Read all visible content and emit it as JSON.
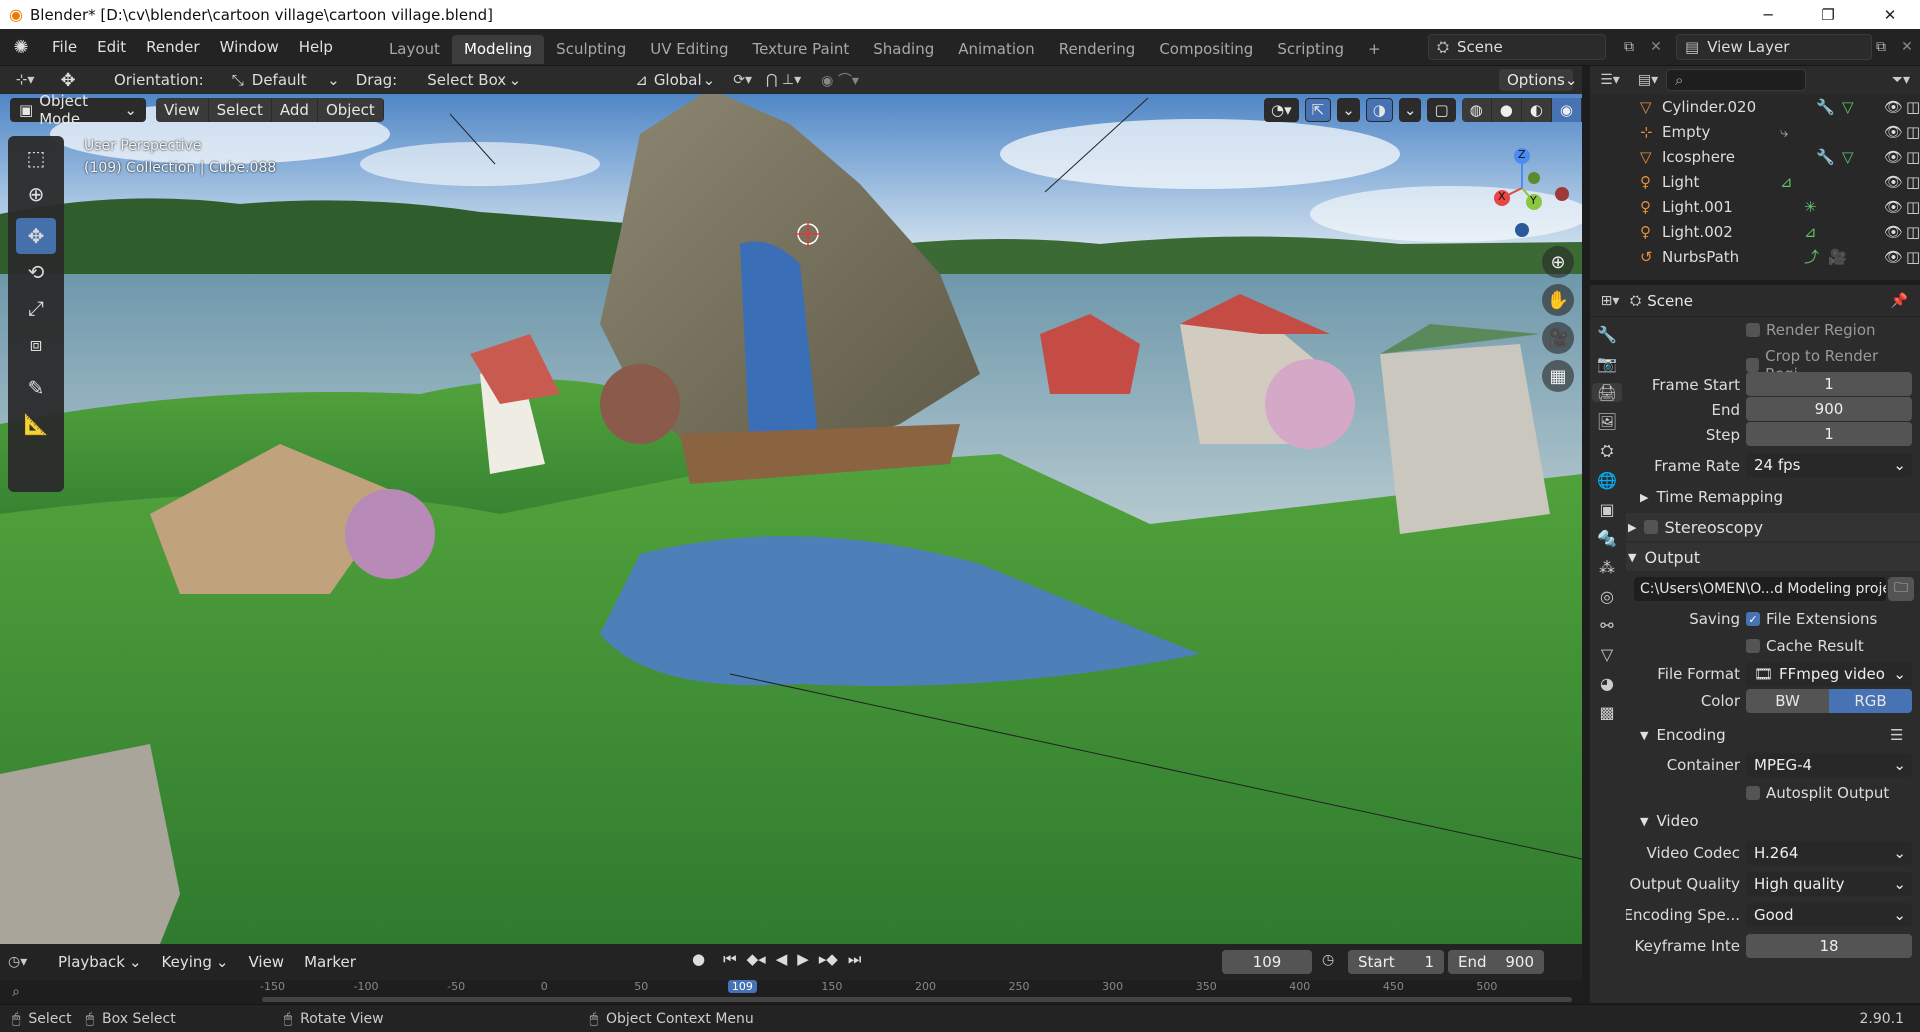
{
  "window": {
    "title": "Blender* [D:\\cv\\blender\\cartoon village\\cartoon village.blend]",
    "min": "─",
    "max": "❐",
    "close": "✕"
  },
  "menu": {
    "items": [
      "File",
      "Edit",
      "Render",
      "Window",
      "Help"
    ],
    "workspaces": [
      "Layout",
      "Modeling",
      "Sculpting",
      "UV Editing",
      "Texture Paint",
      "Shading",
      "Animation",
      "Rendering",
      "Compositing",
      "Scripting"
    ],
    "active_workspace": "Modeling",
    "add_tab": "+",
    "scene_name": "Scene",
    "view_layer": "View Layer"
  },
  "tool_header": {
    "orientation_label": "Orientation:",
    "orientation_value": "Default",
    "drag_label": "Drag:",
    "drag_value": "Select Box",
    "transform_orientation": "Global",
    "options": "Options"
  },
  "viewport_header": {
    "mode": "Object Mode",
    "menus": [
      "View",
      "Select",
      "Add",
      "Object"
    ]
  },
  "viewport": {
    "perspective": "User Perspective",
    "collection_info": "(109) Collection | Cube.088"
  },
  "gizmo": {
    "x": "X",
    "y": "Y",
    "z": "Z"
  },
  "outliner": {
    "search_placeholder": "",
    "items": [
      {
        "name": "Cylinder.020",
        "icon": "mesh-icon"
      },
      {
        "name": "Empty",
        "icon": "empty-icon"
      },
      {
        "name": "Icosphere",
        "icon": "mesh-icon"
      },
      {
        "name": "Light",
        "icon": "light-icon"
      },
      {
        "name": "Light.001",
        "icon": "light-icon"
      },
      {
        "name": "Light.002",
        "icon": "light-icon"
      },
      {
        "name": "NurbsPath",
        "icon": "curve-icon"
      }
    ]
  },
  "properties": {
    "context": "Scene",
    "render_region": "Render Region",
    "crop": "Crop to Render Regi...",
    "frame_start_label": "Frame Start",
    "frame_start": "1",
    "end_label": "End",
    "end": "900",
    "step_label": "Step",
    "step": "1",
    "frame_rate_label": "Frame Rate",
    "frame_rate": "24 fps",
    "time_remapping": "Time Remapping",
    "stereoscopy": "Stereoscopy",
    "output": "Output",
    "output_path": "C:\\Users\\OMEN\\O...d Modeling project",
    "saving_label": "Saving",
    "file_extensions": "File Extensions",
    "cache_result": "Cache Result",
    "file_format_label": "File Format",
    "file_format": "FFmpeg video",
    "color_label": "Color",
    "color_bw": "BW",
    "color_rgb": "RGB",
    "encoding": "Encoding",
    "container_label": "Container",
    "container": "MPEG-4",
    "autosplit": "Autosplit Output",
    "video": "Video",
    "video_codec_label": "Video Codec",
    "video_codec": "H.264",
    "output_quality_label": "Output Quality",
    "output_quality": "High quality",
    "encoding_speed_label": "Encoding Spe...",
    "encoding_speed": "Good",
    "keyframe_label": "Keyframe Inte",
    "keyframe": "18"
  },
  "timeline": {
    "menus": [
      "Playback",
      "Keying",
      "View",
      "Marker"
    ],
    "current_frame": "109",
    "start_label": "Start",
    "start": "1",
    "end_label": "End",
    "end": "900",
    "ruler": [
      "-150",
      "-100",
      "-50",
      "0",
      "50",
      "109",
      "150",
      "200",
      "250",
      "300",
      "350",
      "400",
      "450",
      "500"
    ]
  },
  "statusbar": {
    "select": "Select",
    "box_select": "Box Select",
    "rotate": "Rotate View",
    "context": "Object Context Menu",
    "version": "2.90.1"
  },
  "colors": {
    "accent": "#4772b3",
    "background": "#1d1d1d",
    "panel": "#2c2c2c"
  }
}
